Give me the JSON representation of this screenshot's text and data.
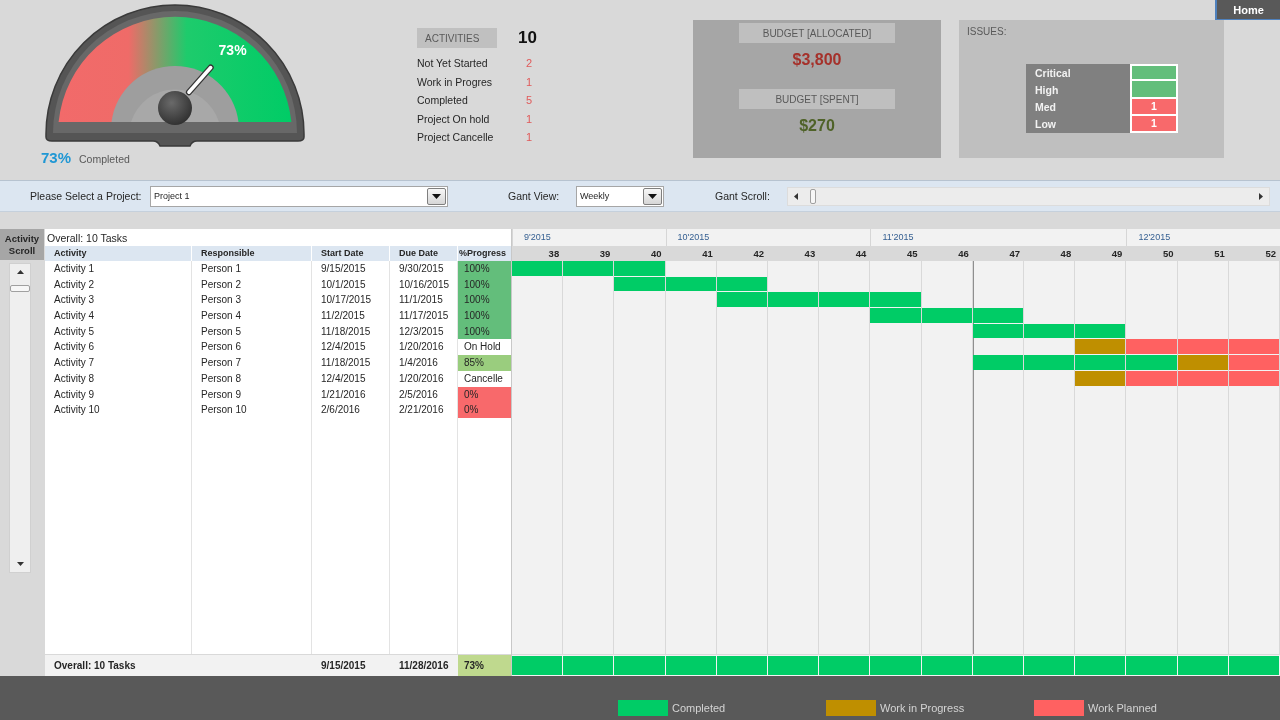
{
  "home_button": {
    "label": "Home"
  },
  "gauge": {
    "level": 0.73,
    "value_label": "73%",
    "caption_value": "73%",
    "caption": "Completed"
  },
  "activities": {
    "label": "ACTIVITIES",
    "total": "10",
    "rows": [
      {
        "label": "Not Yet Started",
        "value": "2"
      },
      {
        "label": "Work in Progres",
        "value": "1"
      },
      {
        "label": "Completed",
        "value": "5"
      },
      {
        "label": "Project On hold",
        "value": "1"
      },
      {
        "label": "Project Cancelle",
        "value": "1"
      }
    ]
  },
  "budget": {
    "allocated_label": "BUDGET [ALLOCATED]",
    "allocated_value": "$3,800",
    "spent_label": "BUDGET [SPENT]",
    "spent_value": "$270"
  },
  "issues": {
    "title": "ISSUES:",
    "rows": [
      {
        "label": "Critical",
        "color": "#63be7b"
      },
      {
        "label": "High",
        "color": "#63be7b"
      },
      {
        "label": "Med",
        "value": "1",
        "color": "#f8696b"
      },
      {
        "label": "Low",
        "value": "1",
        "color": "#f8696b"
      }
    ]
  },
  "controls": {
    "project_label": "Please Select a Project:",
    "project_value": "Project 1",
    "view_label": "Gant View:",
    "view_value": "Weekly",
    "scroll_label": "Gant Scroll:"
  },
  "activity_scroll": {
    "label": "Activity Scroll"
  },
  "table": {
    "overall": "Overall: 10 Tasks",
    "columns": [
      "Activity",
      "Responsible",
      "Start Date",
      "Due Date",
      "%Progress"
    ],
    "rows": [
      {
        "activity": "Activity 1",
        "responsible": "Person 1",
        "start": "9/15/2015",
        "due": "9/30/2015",
        "progress": "100%",
        "color": "#63be7b",
        "timeline": [
          {
            "kind": "completed"
          },
          {
            "kind": "completed"
          },
          {
            "kind": "completed"
          },
          {
            "kind": "none"
          },
          {
            "kind": "none"
          },
          {
            "kind": "none"
          },
          {
            "kind": "none"
          },
          {
            "kind": "none"
          },
          {
            "kind": "none"
          },
          {
            "kind": "none"
          },
          {
            "kind": "none"
          },
          {
            "kind": "none"
          },
          {
            "kind": "none"
          },
          {
            "kind": "none"
          },
          {
            "kind": "none"
          }
        ]
      },
      {
        "activity": "Activity 2",
        "responsible": "Person 2",
        "start": "10/1/2015",
        "due": "10/16/2015",
        "progress": "100%",
        "color": "#63be7b",
        "timeline": [
          {
            "kind": "none"
          },
          {
            "kind": "none"
          },
          {
            "kind": "completed"
          },
          {
            "kind": "completed"
          },
          {
            "kind": "completed"
          },
          {
            "kind": "none"
          },
          {
            "kind": "none"
          },
          {
            "kind": "none"
          },
          {
            "kind": "none"
          },
          {
            "kind": "none"
          },
          {
            "kind": "none"
          },
          {
            "kind": "none"
          },
          {
            "kind": "none"
          },
          {
            "kind": "none"
          },
          {
            "kind": "none"
          }
        ]
      },
      {
        "activity": "Activity 3",
        "responsible": "Person 3",
        "start": "10/17/2015",
        "due": "11/1/2015",
        "progress": "100%",
        "color": "#63be7b",
        "timeline": [
          {
            "kind": "none"
          },
          {
            "kind": "none"
          },
          {
            "kind": "none"
          },
          {
            "kind": "none"
          },
          {
            "kind": "completed"
          },
          {
            "kind": "completed"
          },
          {
            "kind": "completed"
          },
          {
            "kind": "completed"
          },
          {
            "kind": "none"
          },
          {
            "kind": "none"
          },
          {
            "kind": "none"
          },
          {
            "kind": "none"
          },
          {
            "kind": "none"
          },
          {
            "kind": "none"
          },
          {
            "kind": "none"
          }
        ]
      },
      {
        "activity": "Activity 4",
        "responsible": "Person 4",
        "start": "11/2/2015",
        "due": "11/17/2015",
        "progress": "100%",
        "color": "#63be7b",
        "timeline": [
          {
            "kind": "none"
          },
          {
            "kind": "none"
          },
          {
            "kind": "none"
          },
          {
            "kind": "none"
          },
          {
            "kind": "none"
          },
          {
            "kind": "none"
          },
          {
            "kind": "none"
          },
          {
            "kind": "completed"
          },
          {
            "kind": "completed"
          },
          {
            "kind": "completed"
          },
          {
            "kind": "none"
          },
          {
            "kind": "none"
          },
          {
            "kind": "none"
          },
          {
            "kind": "none"
          },
          {
            "kind": "none"
          }
        ]
      },
      {
        "activity": "Activity 5",
        "responsible": "Person 5",
        "start": "11/18/2015",
        "due": "12/3/2015",
        "progress": "100%",
        "color": "#63be7b",
        "timeline": [
          {
            "kind": "none"
          },
          {
            "kind": "none"
          },
          {
            "kind": "none"
          },
          {
            "kind": "none"
          },
          {
            "kind": "none"
          },
          {
            "kind": "none"
          },
          {
            "kind": "none"
          },
          {
            "kind": "none"
          },
          {
            "kind": "none"
          },
          {
            "kind": "completed"
          },
          {
            "kind": "completed"
          },
          {
            "kind": "completed"
          },
          {
            "kind": "none"
          },
          {
            "kind": "none"
          },
          {
            "kind": "none"
          }
        ]
      },
      {
        "activity": "Activity 6",
        "responsible": "Person 6",
        "start": "12/4/2015",
        "due": "1/20/2016",
        "progress": "On Hold",
        "timeline": [
          {
            "kind": "none"
          },
          {
            "kind": "none"
          },
          {
            "kind": "none"
          },
          {
            "kind": "none"
          },
          {
            "kind": "none"
          },
          {
            "kind": "none"
          },
          {
            "kind": "none"
          },
          {
            "kind": "none"
          },
          {
            "kind": "none"
          },
          {
            "kind": "none"
          },
          {
            "kind": "none"
          },
          {
            "kind": "in_progress"
          },
          {
            "kind": "planned"
          },
          {
            "kind": "planned"
          },
          {
            "kind": "planned"
          }
        ]
      },
      {
        "activity": "Activity 7",
        "responsible": "Person 7",
        "start": "11/18/2015",
        "due": "1/4/2016",
        "progress": "85%",
        "color": "#9acd7e",
        "timeline": [
          {
            "kind": "none"
          },
          {
            "kind": "none"
          },
          {
            "kind": "none"
          },
          {
            "kind": "none"
          },
          {
            "kind": "none"
          },
          {
            "kind": "none"
          },
          {
            "kind": "none"
          },
          {
            "kind": "none"
          },
          {
            "kind": "none"
          },
          {
            "kind": "completed"
          },
          {
            "kind": "completed"
          },
          {
            "kind": "completed"
          },
          {
            "kind": "completed"
          },
          {
            "kind": "in_progress"
          },
          {
            "kind": "planned"
          }
        ]
      },
      {
        "activity": "Activity 8",
        "responsible": "Person 8",
        "start": "12/4/2015",
        "due": "1/20/2016",
        "progress": "Cancelle",
        "timeline": [
          {
            "kind": "none"
          },
          {
            "kind": "none"
          },
          {
            "kind": "none"
          },
          {
            "kind": "none"
          },
          {
            "kind": "none"
          },
          {
            "kind": "none"
          },
          {
            "kind": "none"
          },
          {
            "kind": "none"
          },
          {
            "kind": "none"
          },
          {
            "kind": "none"
          },
          {
            "kind": "none"
          },
          {
            "kind": "in_progress"
          },
          {
            "kind": "planned"
          },
          {
            "kind": "planned"
          },
          {
            "kind": "planned"
          }
        ]
      },
      {
        "activity": "Activity 9",
        "responsible": "Person 9",
        "start": "1/21/2016",
        "due": "2/5/2016",
        "progress": "0%",
        "color": "#f8696b"
      },
      {
        "activity": "Activity 10",
        "responsible": "Person 10",
        "start": "2/6/2016",
        "due": "2/21/2016",
        "progress": "0%",
        "color": "#f8696b"
      }
    ],
    "footer": {
      "label": "Overall: 10 Tasks",
      "start": "9/15/2015",
      "due": "11/28/2016",
      "progress": "73%",
      "color": "#bfd98e",
      "timeline": [
        {
          "kind": "completed"
        },
        {
          "kind": "completed"
        },
        {
          "kind": "completed"
        },
        {
          "kind": "completed"
        },
        {
          "kind": "completed"
        },
        {
          "kind": "completed"
        },
        {
          "kind": "completed"
        },
        {
          "kind": "completed"
        },
        {
          "kind": "completed"
        },
        {
          "kind": "completed"
        },
        {
          "kind": "completed"
        },
        {
          "kind": "completed"
        },
        {
          "kind": "completed"
        },
        {
          "kind": "completed"
        },
        {
          "kind": "completed"
        }
      ]
    }
  },
  "gantt": {
    "months": [
      {
        "label": "9'2015",
        "weeks": [
          {
            "label": "38",
            "current": false
          },
          {
            "label": "39",
            "current": false
          },
          {
            "label": "40",
            "current": false
          }
        ]
      },
      {
        "label": "10'2015",
        "weeks": [
          {
            "label": "41",
            "current": false
          },
          {
            "label": "42",
            "current": false
          },
          {
            "label": "43",
            "current": false
          },
          {
            "label": "44",
            "current": false
          }
        ]
      },
      {
        "label": "11'2015",
        "weeks": [
          {
            "label": "45",
            "current": false
          },
          {
            "label": "46",
            "current": false
          },
          {
            "label": "47",
            "current": true
          },
          {
            "label": "48",
            "current": false
          },
          {
            "label": "49",
            "current": false
          }
        ]
      },
      {
        "label": "12'2015",
        "weeks": [
          {
            "label": "50",
            "current": false
          },
          {
            "label": "51",
            "current": false
          },
          {
            "label": "52",
            "current": false
          }
        ]
      }
    ]
  },
  "legend": [
    {
      "kind": "completed",
      "label": "Completed"
    },
    {
      "kind": "in_progress",
      "label": "Work in Progress"
    },
    {
      "kind": "planned",
      "label": "Work Planned"
    }
  ]
}
